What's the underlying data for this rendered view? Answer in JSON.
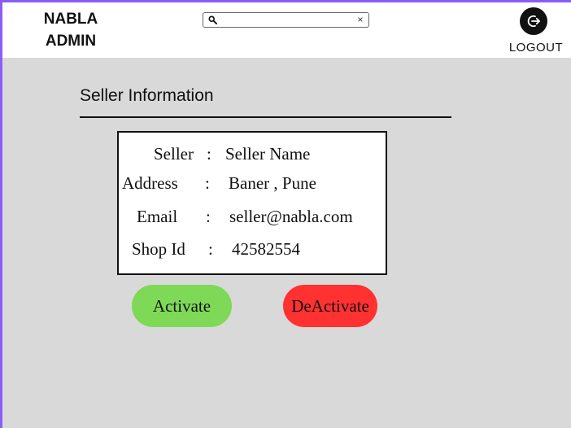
{
  "header": {
    "brand_line1": "NABLA",
    "brand_line2": "ADMIN",
    "search": {
      "value": "",
      "placeholder": "",
      "icon": "search-icon",
      "clear_label": "×"
    },
    "logout": {
      "icon": "logout-icon",
      "label": "LOGOUT"
    }
  },
  "main": {
    "section_title": "Seller Information",
    "fields": [
      {
        "label": "Seller",
        "separator": ":",
        "value": "Seller Name"
      },
      {
        "label": "Address",
        "separator": ":",
        "value": "Baner , Pune"
      },
      {
        "label": "Email",
        "separator": ":",
        "value": "seller@nabla.com"
      },
      {
        "label": "Shop Id",
        "separator": ":",
        "value": "42582554"
      }
    ],
    "actions": {
      "activate_label": "Activate",
      "deactivate_label": "DeActivate"
    }
  },
  "colors": {
    "accent": "#8b5cf6",
    "background": "#d9d9d9",
    "activate": "#7ed957",
    "deactivate": "#ff3131"
  }
}
